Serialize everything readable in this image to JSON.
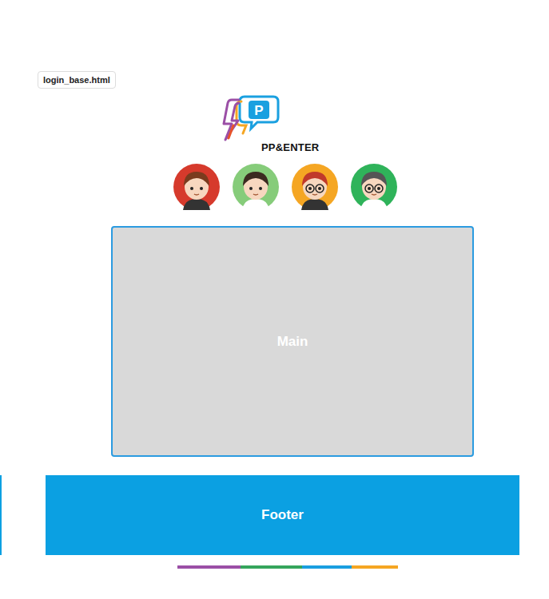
{
  "frame": {
    "label": "login_base.html"
  },
  "logo": {
    "letter": "P",
    "brand": "PP&ENTER"
  },
  "avatars": [
    {
      "color": "#d63a2c"
    },
    {
      "color": "#86cc7a"
    },
    {
      "color": "#f5a623"
    },
    {
      "color": "#2fb35a"
    }
  ],
  "main": {
    "label": "Main"
  },
  "footer": {
    "label": "Footer"
  },
  "color_bar": [
    {
      "color": "#9b4fa6"
    },
    {
      "color": "#35a55c"
    },
    {
      "color": "#1a9ee0"
    },
    {
      "color": "#f5a623"
    }
  ]
}
